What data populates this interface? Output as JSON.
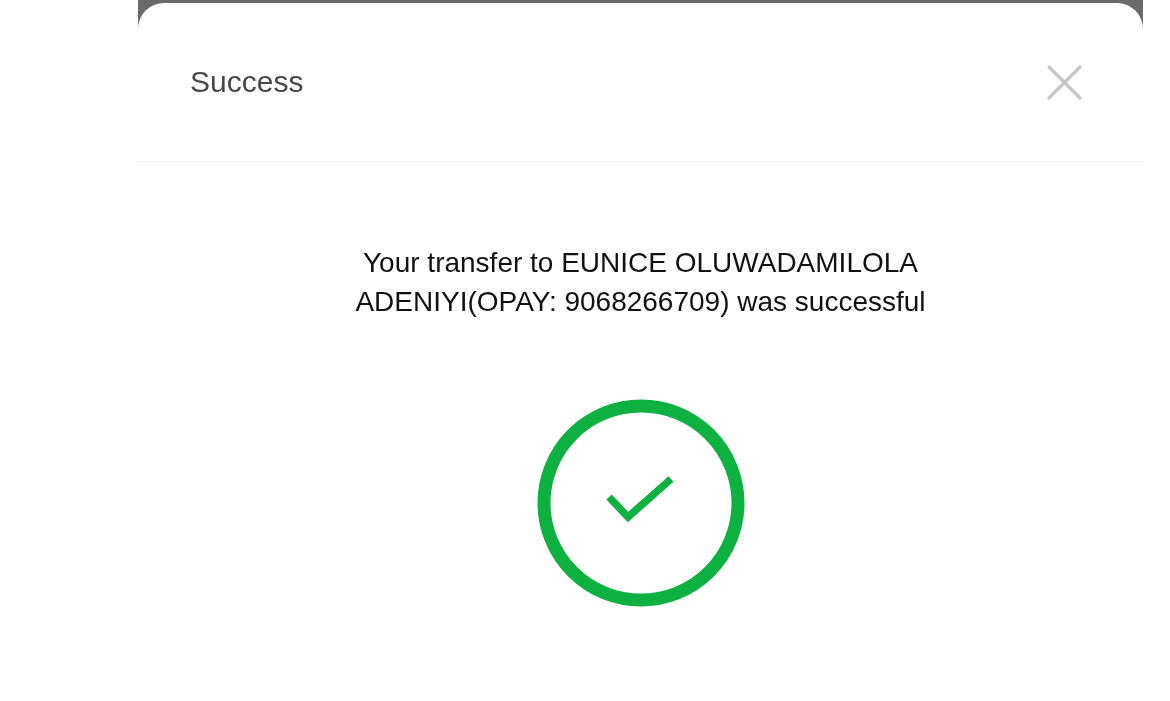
{
  "dialog": {
    "title": "Success",
    "message": "Your transfer to EUNICE OLUWADAMILOLA ADENIYI(OPAY: 9068266709) was successful",
    "kind": "success"
  }
}
